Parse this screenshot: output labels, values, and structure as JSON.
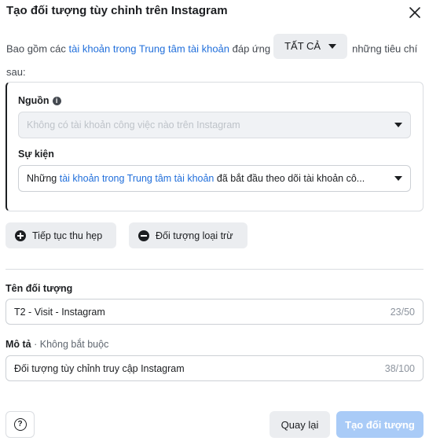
{
  "dialog": {
    "title": "Tạo đối tượng tùy chỉnh trên Instagram"
  },
  "criteria": {
    "prefix": "Bao gồm các ",
    "link_text": "tài khoản trong Trung tâm tài khoản",
    "middle": " đáp ứng",
    "match_selected": "TẤT CẢ",
    "suffix": "những tiêu chí sau:"
  },
  "rule": {
    "source_label": "Nguồn",
    "source_placeholder": "Không có tài khoản công việc nào trên Instagram",
    "event_label": "Sự kiện",
    "event_prefix": "Những ",
    "event_link": "tài khoản trong Trung tâm tài khoản",
    "event_suffix": " đã bắt đầu theo dõi tài khoản cô..."
  },
  "actions": {
    "narrow_label": "Tiếp tục thu hẹp",
    "exclude_label": "Đối tượng loại trừ"
  },
  "name_field": {
    "label": "Tên đối tượng",
    "value": "T2 - Visit - Instagram",
    "counter": "23/50"
  },
  "description_field": {
    "label": "Mô tả",
    "optional": " · Không bắt buộc",
    "value": "Đối tượng tùy chỉnh truy cập Instagram",
    "counter": "38/100"
  },
  "footer": {
    "back_label": "Quay lại",
    "create_label": "Tạo đối tượng"
  },
  "colors": {
    "link": "#216fdb",
    "primary_disabled": "#a9cbf7",
    "secondary_bg": "#ebedf0"
  }
}
